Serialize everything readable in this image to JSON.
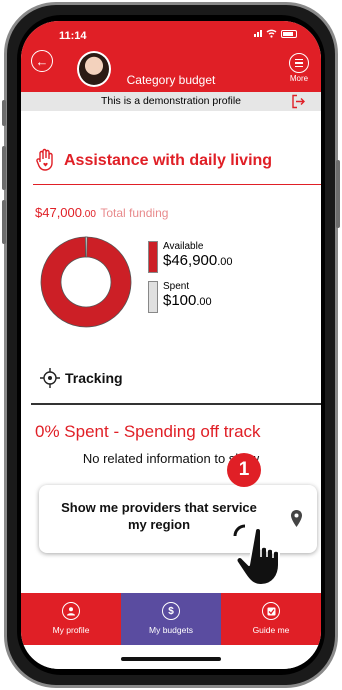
{
  "status": {
    "time": "11:14"
  },
  "header": {
    "title": "Category budget",
    "more_label": "More"
  },
  "demo_banner": "This is a demonstration profile",
  "category": {
    "title": "Assistance with daily living",
    "total_amount": "$47,000",
    "total_cents": ".00",
    "total_label": "Total funding"
  },
  "chart_data": {
    "type": "pie",
    "labels": [
      "Available",
      "Spent"
    ],
    "values": [
      46900,
      100
    ],
    "colors": [
      "#cc1f26",
      "#e0e0e0"
    ]
  },
  "legend": [
    {
      "label": "Available",
      "amount": "$46,900",
      "cents": ".00",
      "color": "#cc1f26"
    },
    {
      "label": "Spent",
      "amount": "$100",
      "cents": ".00",
      "color": "#e0e0e0"
    }
  ],
  "tracking": {
    "title": "Tracking",
    "status": "0% Spent - Spending off track",
    "no_info": "No related information to show"
  },
  "provider_button": {
    "label_line1": "Show me providers that service",
    "label_line2": "my region"
  },
  "step_badge": "1",
  "bottom_nav": [
    {
      "label": "My profile",
      "icon": "person-icon",
      "active": false
    },
    {
      "label": "My budgets",
      "icon": "dollar-icon",
      "active": true
    },
    {
      "label": "Guide me",
      "icon": "checkbox-icon",
      "active": false
    }
  ],
  "colors": {
    "brand_red": "#e01f26",
    "active_nav": "#5a4ca0"
  }
}
